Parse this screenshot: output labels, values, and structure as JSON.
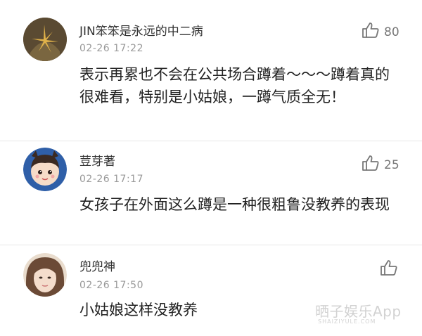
{
  "comments": [
    {
      "username": "JIN笨笨是永远的中二病",
      "time": "02-26 17:22",
      "text": "表示再累也不会在公共场合蹲着～～～蹲着真的很难看，特别是小姑娘，一蹲气质全无！",
      "likes": "80"
    },
    {
      "username": "荳芽著",
      "time": "02-26 17:17",
      "text": "女孩子在外面这么蹲是一种很粗鲁没教养的表现",
      "likes": "25"
    },
    {
      "username": "兜兜神",
      "time": "02-26 17:50",
      "text": "小姑娘这样没教养",
      "likes": ""
    }
  ],
  "watermark": {
    "title": "晒子娱乐App",
    "sub": "SHAIZIYULE.COM"
  },
  "icons": {
    "like": "thumbs-up-icon"
  },
  "colors": {
    "text": "#222222",
    "muted": "#999999",
    "divider": "#e6e6e6"
  }
}
